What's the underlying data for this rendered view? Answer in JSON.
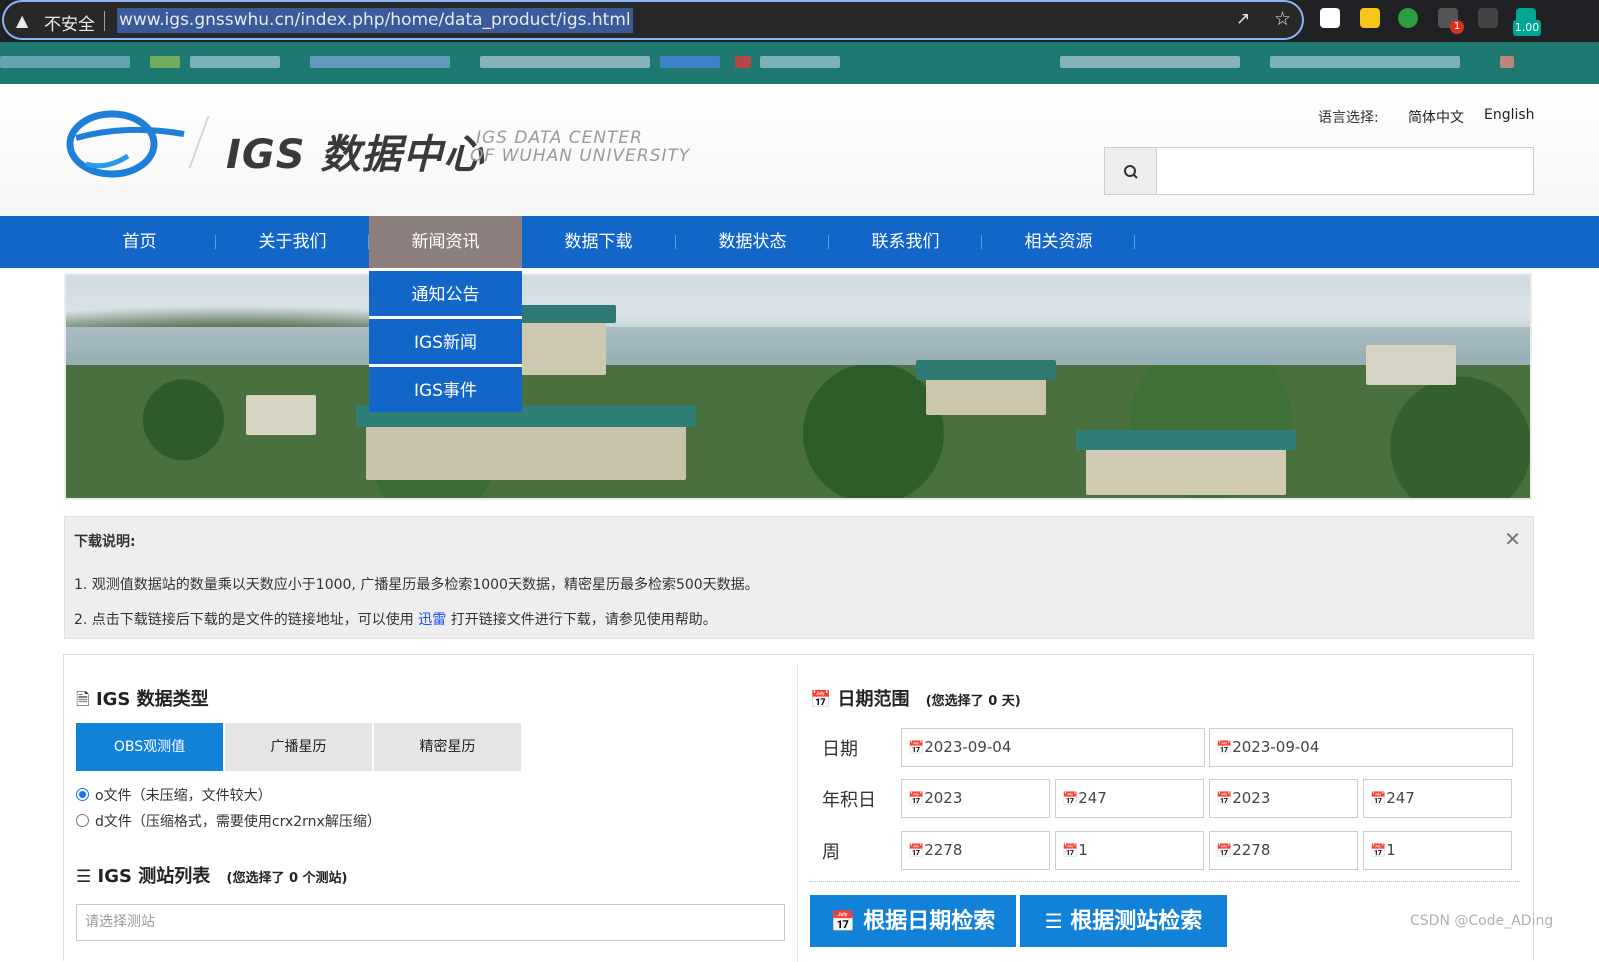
{
  "browser": {
    "security_label": "不安全",
    "url": "www.igs.gnsswhu.cn/index.php/home/data_product/igs.html",
    "ext_badge_count": "1",
    "zoom": "1.00"
  },
  "header": {
    "logo_title": "IGS 数据中心",
    "logo_sub1": "IGS DATA CENTER",
    "logo_sub2": "OF WUHAN UNIVERSITY",
    "lang_label": "语言选择:",
    "lang_zh": "简体中文",
    "lang_en": "English",
    "search_placeholder": ""
  },
  "nav": {
    "items": [
      "首页",
      "关于我们",
      "新闻资讯",
      "数据下载",
      "数据状态",
      "联系我们",
      "相关资源"
    ],
    "active_index": 2,
    "dropdown": [
      "通知公告",
      "IGS新闻",
      "IGS事件"
    ]
  },
  "notice": {
    "title": "下载说明:",
    "line1": "1. 观测值数据站的数量乘以天数应小于1000, 广播星历最多检索1000天数据，精密星历最多检索500天数据。",
    "line2_pre": "2. 点击下载链接后下载的是文件的链接地址，可以使用",
    "line2_link": "迅雷",
    "line2_post": "打开链接文件进行下载，请参见使用帮助。"
  },
  "data_type": {
    "title": "IGS 数据类型",
    "tabs": [
      "OBS观测值",
      "广播星历",
      "精密星历"
    ],
    "active_tab": 0,
    "option_o": "o文件（未压缩，文件较大）",
    "option_d": "d文件（压缩格式，需要使用crx2rnx解压缩）",
    "selected_option": "o"
  },
  "station_list": {
    "title": "IGS 测站列表",
    "note": "(您选择了 0 个测站)",
    "placeholder": "请选择测站"
  },
  "date_range": {
    "title": "日期范围",
    "note": "(您选择了 0 天)",
    "row_date_label": "日期",
    "row_doy_label": "年积日",
    "row_week_label": "周",
    "start_date": "2023-09-04",
    "end_date": "2023-09-04",
    "start_year": "2023",
    "start_doy": "247",
    "end_year": "2023",
    "end_doy": "247",
    "start_week": "2278",
    "start_weekday": "1",
    "end_week": "2278",
    "end_weekday": "1",
    "btn_by_date": "根据日期检索",
    "btn_by_station": "根据测站检索"
  },
  "watermark": "CSDN @Code_ADing",
  "colors": {
    "nav_blue": "#1266c8",
    "nav_active": "#8e7f7f",
    "button_blue": "#1281d8",
    "notice_bg": "#eeeeee"
  }
}
